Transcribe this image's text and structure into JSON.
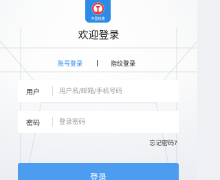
{
  "app": {
    "logo_text": "中国铁路",
    "title": "欢迎登录"
  },
  "tabs": {
    "account_login": "账号登录",
    "separator": "|",
    "fingerprint_login": "指纹登录"
  },
  "form": {
    "username_label": "用户",
    "username_placeholder": "用户名/邮箱/手机号码",
    "password_label": "密码",
    "password_placeholder": "登录密码",
    "forgot_password": "忘记密码?",
    "login_button": "登录"
  },
  "colors": {
    "accent": "#2e8ae6",
    "button": "#4c9cf0",
    "logo_bg": "#2b8be6",
    "logo_mark": "#e23d3d"
  },
  "icons": {
    "logo": "china-railway-logo-icon"
  }
}
